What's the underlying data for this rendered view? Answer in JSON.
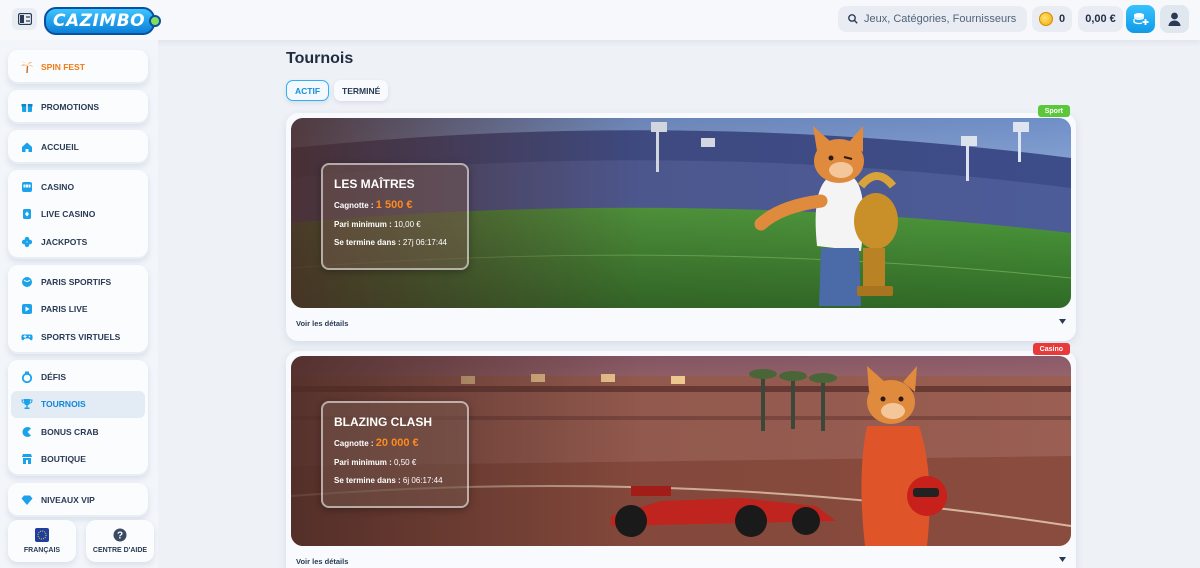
{
  "header": {
    "logo": "CAZIMBO",
    "search_placeholder": "Jeux, Catégories, Fournisseurs",
    "coins": "0",
    "balance": "0,00 €"
  },
  "sidebar": {
    "groups": [
      [
        {
          "label": "SPIN FEST",
          "icon": "palm-icon"
        }
      ],
      [
        {
          "label": "PROMOTIONS",
          "icon": "gift-icon"
        }
      ],
      [
        {
          "label": "ACCUEIL",
          "icon": "home-icon"
        }
      ],
      [
        {
          "label": "CASINO",
          "icon": "slot-icon"
        },
        {
          "label": "LIVE CASINO",
          "icon": "live-card-icon"
        },
        {
          "label": "JACKPOTS",
          "icon": "clover-icon"
        }
      ],
      [
        {
          "label": "PARIS SPORTIFS",
          "icon": "ball-icon"
        },
        {
          "label": "PARIS LIVE",
          "icon": "play-icon"
        },
        {
          "label": "SPORTS VIRTUELS",
          "icon": "gamepad-icon"
        }
      ],
      [
        {
          "label": "DÉFIS",
          "icon": "medal-icon"
        },
        {
          "label": "TOURNOIS",
          "icon": "trophy-icon"
        },
        {
          "label": "BONUS CRAB",
          "icon": "crab-icon"
        },
        {
          "label": "BOUTIQUE",
          "icon": "shop-icon"
        }
      ],
      [
        {
          "label": "NIVEAUX VIP",
          "icon": "diamond-icon"
        }
      ]
    ],
    "language": "FRANÇAIS",
    "help": "CENTRE D'AIDE"
  },
  "main": {
    "title": "Tournois",
    "tabs": [
      {
        "label": "ACTIF"
      },
      {
        "label": "TERMINÉ"
      }
    ],
    "tournaments": [
      {
        "tag": "Sport",
        "tag_color": "#5ac83a",
        "name": "LES MAÎTRES",
        "pot_label": "Cagnotte :",
        "pot": "1 500 €",
        "min_label": "Pari minimum :",
        "min": "10,00 €",
        "end_label": "Se termine dans :",
        "end": "27j 06:17:44",
        "details": "Voir les détails"
      },
      {
        "tag": "Casino",
        "tag_color": "#e83a3a",
        "name": "BLAZING CLASH",
        "pot_label": "Cagnotte :",
        "pot": "20 000 €",
        "min_label": "Pari minimum :",
        "min": "0,50 €",
        "end_label": "Se termine dans :",
        "end": "6j 06:17:44",
        "details": "Voir les détails"
      }
    ]
  }
}
